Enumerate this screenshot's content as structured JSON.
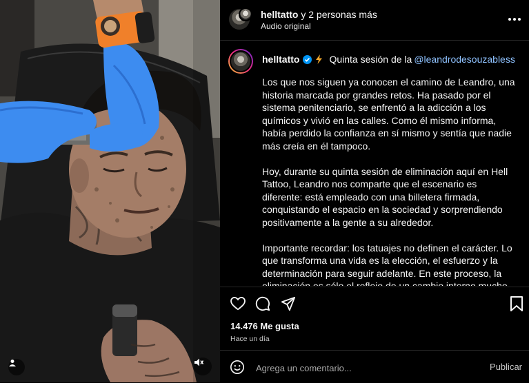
{
  "media": {
    "alt_icons": [
      "user-tag-icon",
      "mute-icon"
    ]
  },
  "header": {
    "username": "helltatto",
    "others": " y 2 personas más",
    "audio": "Audio original",
    "more_icon": "more-horizontal-icon"
  },
  "caption": {
    "username": "helltatto",
    "intro": "Quinta sesión de la",
    "mention": "@leandrodesouzabless",
    "paragraphs": [
      "Los que nos siguen ya conocen el camino de Leandro, una historia marcada por grandes retos. Ha pasado por el sistema penitenciario, se enfrentó a la adicción a los químicos y vivió en las calles. Como él mismo informa, había perdido la confianza en sí mismo y sentía que nadie más creía en él tampoco.",
      "Hoy, durante su quinta sesión de eliminación aquí en Hell Tattoo, Leandro nos comparte que el escenario es diferente: está empleado con una billetera firmada, conquistando el espacio en la sociedad y sorprendiendo positivamente a la gente a su alrededor.",
      "Importante recordar: los tatuajes no definen el carácter. Lo que transforma una vida es la elección, el esfuerzo y la determinación para seguir adelante. En este proceso, la eliminación es sólo el reflejo de un cambio interno mucho mayor y que ayuda a alinear la imagen externa con la nueva identidad que se está construyendo."
    ]
  },
  "stats": {
    "likes": "14.476 Me gusta",
    "time": "Hace un día"
  },
  "comment": {
    "placeholder": "Agrega un comentario...",
    "publish": "Publicar"
  },
  "colors": {
    "background": "#000000",
    "verified": "#0095f6",
    "mention": "#8fc2ff",
    "glove": "#3d8cf0",
    "strap": "#f0802a"
  }
}
